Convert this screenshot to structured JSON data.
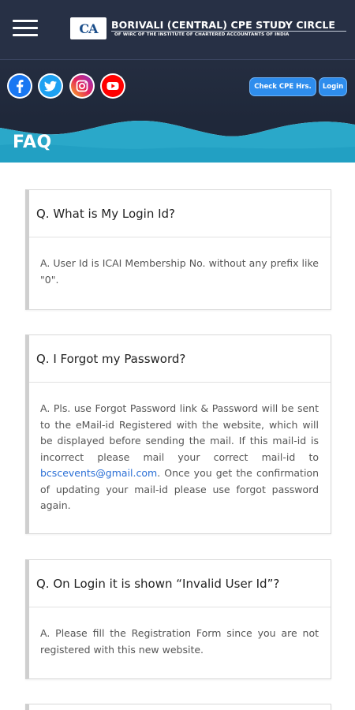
{
  "header": {
    "logo_text": "CA",
    "title": "BORIVALI (CENTRAL) CPE STUDY CIRCLE",
    "subtitle": "OF WIRC OF THE INSTITUTE OF CHARTERED ACCOUNTANTS OF INDIA",
    "social": [
      {
        "name": "facebook-icon",
        "color": "#1877f2"
      },
      {
        "name": "twitter-icon",
        "color": "#1da1f2"
      },
      {
        "name": "instagram-icon",
        "color": "#d6249f"
      },
      {
        "name": "youtube-icon",
        "color": "#ff0000"
      }
    ],
    "check_cpe_label": "Check CPE Hrs.",
    "login_label": "Login"
  },
  "page": {
    "title": "FAQ"
  },
  "faq": [
    {
      "question": "Q. What is My Login Id?",
      "answer": "A. User Id is ICAI Membership No. without any prefix like \"0\"."
    },
    {
      "question": "Q. I Forgot my Password?",
      "answer_before": "A. Pls. use Forgot Password link & Password will be sent to the eMail-id Registered with the website, which will be displayed before sending the mail. If this mail-id is incorrect please mail your correct mail-id to ",
      "answer_link": "bcscevents@gmail.com",
      "answer_after": ". Once you get the confirmation of updating your mail-id please use forgot password again."
    },
    {
      "question": "Q. On Login it is shown “Invalid User Id”?",
      "answer": "A. Please fill the Registration Form since you are not registered with this new website."
    }
  ],
  "colors": {
    "header_bg": "#273045",
    "wave_teal": "#2aa8c9",
    "button_blue": "#2e8ded",
    "link_blue": "#2a6fd6"
  }
}
